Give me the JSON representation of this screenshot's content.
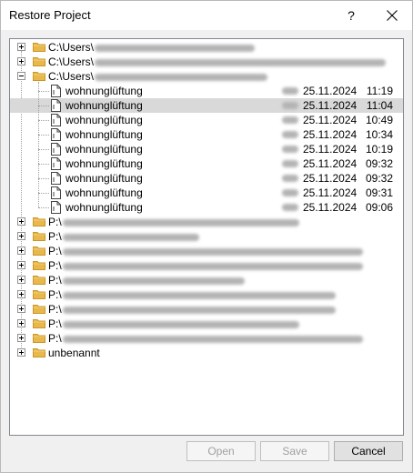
{
  "window": {
    "title": "Restore Project",
    "help_label": "?"
  },
  "tree": {
    "groups_top": [
      {
        "prefix": "C:\\Users\\",
        "expanded": false
      },
      {
        "prefix": "C:\\Users\\",
        "expanded": false
      },
      {
        "prefix": "C:\\Users\\",
        "expanded": true
      }
    ],
    "versions": [
      {
        "name": "wohnunglüftung",
        "date": "25.11.2024",
        "time": "11:19"
      },
      {
        "name": "wohnunglüftung",
        "date": "25.11.2024",
        "time": "11:04",
        "selected": true
      },
      {
        "name": "wohnunglüftung",
        "date": "25.11.2024",
        "time": "10:49"
      },
      {
        "name": "wohnunglüftung",
        "date": "25.11.2024",
        "time": "10:34"
      },
      {
        "name": "wohnunglüftung",
        "date": "25.11.2024",
        "time": "10:19"
      },
      {
        "name": "wohnunglüftung",
        "date": "25.11.2024",
        "time": "09:32"
      },
      {
        "name": "wohnunglüftung",
        "date": "25.11.2024",
        "time": "09:32"
      },
      {
        "name": "wohnunglüftung",
        "date": "25.11.2024",
        "time": "09:31"
      },
      {
        "name": "wohnunglüftung",
        "date": "25.11.2024",
        "time": "09:06"
      }
    ],
    "groups_bottom": [
      {
        "prefix": "P:\\"
      },
      {
        "prefix": "P:\\"
      },
      {
        "prefix": "P:\\"
      },
      {
        "prefix": "P:\\"
      },
      {
        "prefix": "P:\\"
      },
      {
        "prefix": "P:\\"
      },
      {
        "prefix": "P:\\"
      },
      {
        "prefix": "P:\\"
      },
      {
        "prefix": "P:\\"
      },
      {
        "prefix": "unbenannt"
      }
    ]
  },
  "buttons": {
    "open": "Open",
    "save": "Save",
    "cancel": "Cancel"
  },
  "colors": {
    "folder": "#e8b84a",
    "selection": "#d9d9d9"
  }
}
